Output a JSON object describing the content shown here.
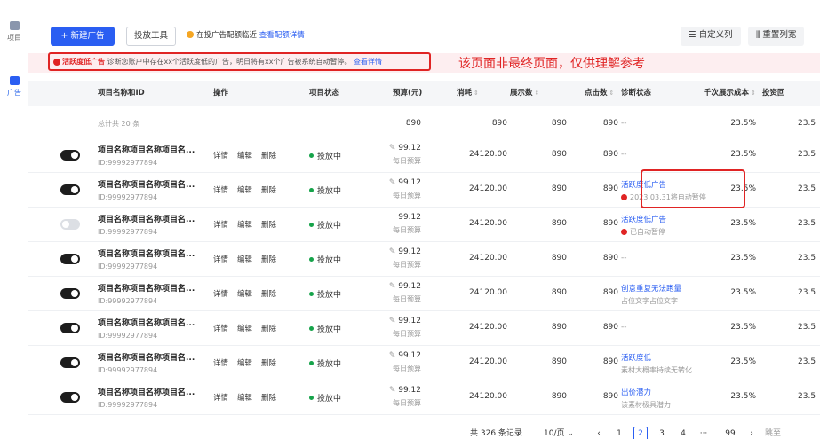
{
  "sidebar": {
    "items": [
      {
        "label": "项目",
        "icon": "project-icon"
      },
      {
        "label": "广告",
        "icon": "ad-icon"
      }
    ]
  },
  "toolbar": {
    "new_ad": "+ 新建广告",
    "tools": "投放工具",
    "tip_text": "在投广告配额临近",
    "tip_link": "查看配额详情",
    "custom_columns": "自定义列",
    "reset_columns": "重置列宽"
  },
  "alert": {
    "tag": "活跃度低广告",
    "text": "诊断您账户中存在xx个活跃度低的广告，明日将有xx个广告被系统自动暂停。",
    "link": "查看详情"
  },
  "notice": "该页面非最终页面，仅供理解参考",
  "table": {
    "headers": {
      "name": "项目名称和ID",
      "ops": "操作",
      "status": "项目状态",
      "budget": "预算(元)",
      "cost": "消耗",
      "impressions": "展示数",
      "clicks": "点击数",
      "diagnosis": "诊断状态",
      "cpm": "千次展示成本",
      "roi": "投资回"
    },
    "summary": {
      "label": "总计共 20 条",
      "budget": "890",
      "cost": "890",
      "impressions": "890",
      "clicks": "890",
      "diagnosis": "--",
      "cpm": "23.5%",
      "roi": "23.5"
    },
    "ops": {
      "detail": "详情",
      "edit": "编辑",
      "delete": "删除"
    },
    "budget_sub": "每日预算",
    "rows": [
      {
        "name": "项目名称项目名称项目名...",
        "id": "ID:99992977894",
        "status": "投放中",
        "budget": "99.12",
        "cost": "24120.00",
        "impressions": "890",
        "clicks": "890",
        "diag_title": "--",
        "diag_desc": "",
        "cpm": "23.5%",
        "roi": "23.5",
        "on": true
      },
      {
        "name": "项目名称项目名称项目名...",
        "id": "ID:99992977894",
        "status": "投放中",
        "budget": "99.12",
        "cost": "24120.00",
        "impressions": "890",
        "clicks": "890",
        "diag_title": "活跃度低广告",
        "diag_desc": "2023.03.31将自动暂停",
        "cpm": "23.5%",
        "roi": "23.5",
        "on": true
      },
      {
        "name": "项目名称项目名称项目名...",
        "id": "ID:99992977894",
        "status": "投放中",
        "budget": "99.12",
        "cost": "24120.00",
        "impressions": "890",
        "clicks": "890",
        "diag_title": "活跃度低广告",
        "diag_desc": "已自动暂停",
        "cpm": "23.5%",
        "roi": "23.5",
        "on": false
      },
      {
        "name": "项目名称项目名称项目名...",
        "id": "ID:99992977894",
        "status": "投放中",
        "budget": "99.12",
        "cost": "24120.00",
        "impressions": "890",
        "clicks": "890",
        "diag_title": "--",
        "diag_desc": "",
        "cpm": "23.5%",
        "roi": "23.5",
        "on": true
      },
      {
        "name": "项目名称项目名称项目名...",
        "id": "ID:99992977894",
        "status": "投放中",
        "budget": "99.12",
        "cost": "24120.00",
        "impressions": "890",
        "clicks": "890",
        "diag_title": "创意重复无法跑量",
        "diag_desc": "占位文字占位文字",
        "cpm": "23.5%",
        "roi": "23.5",
        "on": true
      },
      {
        "name": "项目名称项目名称项目名...",
        "id": "ID:99992977894",
        "status": "投放中",
        "budget": "99.12",
        "cost": "24120.00",
        "impressions": "890",
        "clicks": "890",
        "diag_title": "--",
        "diag_desc": "",
        "cpm": "23.5%",
        "roi": "23.5",
        "on": true
      },
      {
        "name": "项目名称项目名称项目名...",
        "id": "ID:99992977894",
        "status": "投放中",
        "budget": "99.12",
        "cost": "24120.00",
        "impressions": "890",
        "clicks": "890",
        "diag_title": "活跃度低",
        "diag_desc": "素材大概率持续无转化",
        "cpm": "23.5%",
        "roi": "23.5",
        "on": true
      },
      {
        "name": "项目名称项目名称项目名...",
        "id": "ID:99992977894",
        "status": "投放中",
        "budget": "99.12",
        "cost": "24120.00",
        "impressions": "890",
        "clicks": "890",
        "diag_title": "出价潜力",
        "diag_desc": "该素材极具潜力",
        "cpm": "23.5%",
        "roi": "23.5",
        "on": true
      }
    ]
  },
  "pagination": {
    "total": "共 326 条记录",
    "page_size": "10/页",
    "pages": [
      "1",
      "2",
      "3",
      "4",
      "···",
      "99"
    ],
    "current": "2",
    "goto": "跳至"
  }
}
